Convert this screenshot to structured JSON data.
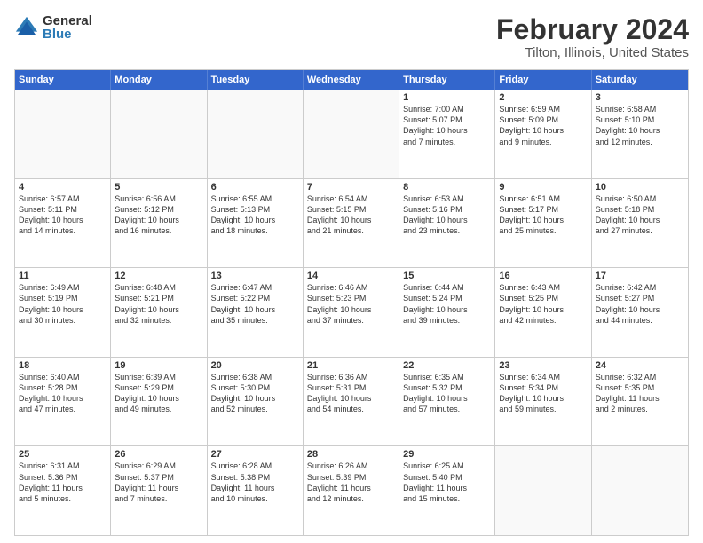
{
  "logo": {
    "general": "General",
    "blue": "Blue"
  },
  "title": "February 2024",
  "subtitle": "Tilton, Illinois, United States",
  "days": [
    "Sunday",
    "Monday",
    "Tuesday",
    "Wednesday",
    "Thursday",
    "Friday",
    "Saturday"
  ],
  "weeks": [
    [
      {
        "day": "",
        "info": ""
      },
      {
        "day": "",
        "info": ""
      },
      {
        "day": "",
        "info": ""
      },
      {
        "day": "",
        "info": ""
      },
      {
        "day": "1",
        "info": "Sunrise: 7:00 AM\nSunset: 5:07 PM\nDaylight: 10 hours\nand 7 minutes."
      },
      {
        "day": "2",
        "info": "Sunrise: 6:59 AM\nSunset: 5:09 PM\nDaylight: 10 hours\nand 9 minutes."
      },
      {
        "day": "3",
        "info": "Sunrise: 6:58 AM\nSunset: 5:10 PM\nDaylight: 10 hours\nand 12 minutes."
      }
    ],
    [
      {
        "day": "4",
        "info": "Sunrise: 6:57 AM\nSunset: 5:11 PM\nDaylight: 10 hours\nand 14 minutes."
      },
      {
        "day": "5",
        "info": "Sunrise: 6:56 AM\nSunset: 5:12 PM\nDaylight: 10 hours\nand 16 minutes."
      },
      {
        "day": "6",
        "info": "Sunrise: 6:55 AM\nSunset: 5:13 PM\nDaylight: 10 hours\nand 18 minutes."
      },
      {
        "day": "7",
        "info": "Sunrise: 6:54 AM\nSunset: 5:15 PM\nDaylight: 10 hours\nand 21 minutes."
      },
      {
        "day": "8",
        "info": "Sunrise: 6:53 AM\nSunset: 5:16 PM\nDaylight: 10 hours\nand 23 minutes."
      },
      {
        "day": "9",
        "info": "Sunrise: 6:51 AM\nSunset: 5:17 PM\nDaylight: 10 hours\nand 25 minutes."
      },
      {
        "day": "10",
        "info": "Sunrise: 6:50 AM\nSunset: 5:18 PM\nDaylight: 10 hours\nand 27 minutes."
      }
    ],
    [
      {
        "day": "11",
        "info": "Sunrise: 6:49 AM\nSunset: 5:19 PM\nDaylight: 10 hours\nand 30 minutes."
      },
      {
        "day": "12",
        "info": "Sunrise: 6:48 AM\nSunset: 5:21 PM\nDaylight: 10 hours\nand 32 minutes."
      },
      {
        "day": "13",
        "info": "Sunrise: 6:47 AM\nSunset: 5:22 PM\nDaylight: 10 hours\nand 35 minutes."
      },
      {
        "day": "14",
        "info": "Sunrise: 6:46 AM\nSunset: 5:23 PM\nDaylight: 10 hours\nand 37 minutes."
      },
      {
        "day": "15",
        "info": "Sunrise: 6:44 AM\nSunset: 5:24 PM\nDaylight: 10 hours\nand 39 minutes."
      },
      {
        "day": "16",
        "info": "Sunrise: 6:43 AM\nSunset: 5:25 PM\nDaylight: 10 hours\nand 42 minutes."
      },
      {
        "day": "17",
        "info": "Sunrise: 6:42 AM\nSunset: 5:27 PM\nDaylight: 10 hours\nand 44 minutes."
      }
    ],
    [
      {
        "day": "18",
        "info": "Sunrise: 6:40 AM\nSunset: 5:28 PM\nDaylight: 10 hours\nand 47 minutes."
      },
      {
        "day": "19",
        "info": "Sunrise: 6:39 AM\nSunset: 5:29 PM\nDaylight: 10 hours\nand 49 minutes."
      },
      {
        "day": "20",
        "info": "Sunrise: 6:38 AM\nSunset: 5:30 PM\nDaylight: 10 hours\nand 52 minutes."
      },
      {
        "day": "21",
        "info": "Sunrise: 6:36 AM\nSunset: 5:31 PM\nDaylight: 10 hours\nand 54 minutes."
      },
      {
        "day": "22",
        "info": "Sunrise: 6:35 AM\nSunset: 5:32 PM\nDaylight: 10 hours\nand 57 minutes."
      },
      {
        "day": "23",
        "info": "Sunrise: 6:34 AM\nSunset: 5:34 PM\nDaylight: 10 hours\nand 59 minutes."
      },
      {
        "day": "24",
        "info": "Sunrise: 6:32 AM\nSunset: 5:35 PM\nDaylight: 11 hours\nand 2 minutes."
      }
    ],
    [
      {
        "day": "25",
        "info": "Sunrise: 6:31 AM\nSunset: 5:36 PM\nDaylight: 11 hours\nand 5 minutes."
      },
      {
        "day": "26",
        "info": "Sunrise: 6:29 AM\nSunset: 5:37 PM\nDaylight: 11 hours\nand 7 minutes."
      },
      {
        "day": "27",
        "info": "Sunrise: 6:28 AM\nSunset: 5:38 PM\nDaylight: 11 hours\nand 10 minutes."
      },
      {
        "day": "28",
        "info": "Sunrise: 6:26 AM\nSunset: 5:39 PM\nDaylight: 11 hours\nand 12 minutes."
      },
      {
        "day": "29",
        "info": "Sunrise: 6:25 AM\nSunset: 5:40 PM\nDaylight: 11 hours\nand 15 minutes."
      },
      {
        "day": "",
        "info": ""
      },
      {
        "day": "",
        "info": ""
      }
    ]
  ]
}
